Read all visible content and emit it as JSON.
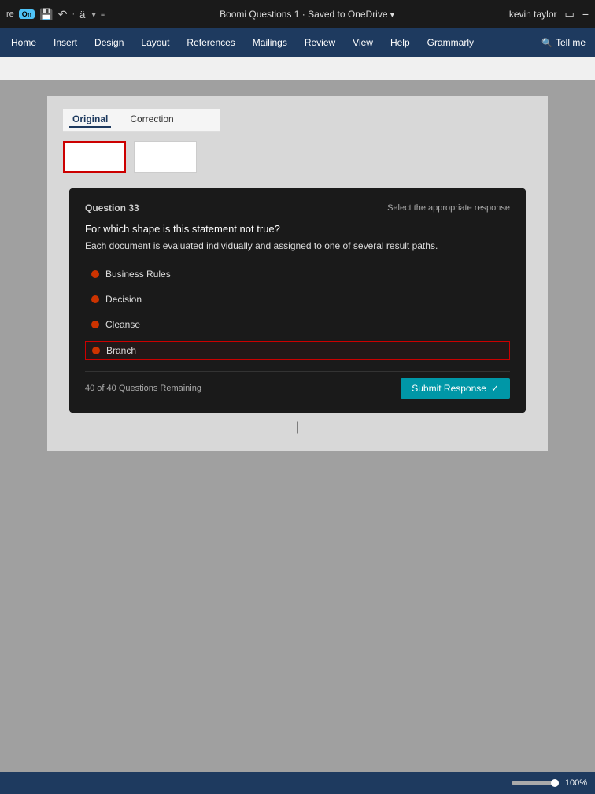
{
  "titlebar": {
    "on_label": "On",
    "doc_title": "Boomi Questions 1",
    "save_status": "Saved to OneDrive",
    "user_name": "kevin taylor"
  },
  "menubar": {
    "items": [
      {
        "label": "Home",
        "id": "home"
      },
      {
        "label": "Insert",
        "id": "insert"
      },
      {
        "label": "Design",
        "id": "design"
      },
      {
        "label": "Layout",
        "id": "layout"
      },
      {
        "label": "References",
        "id": "references"
      },
      {
        "label": "Mailings",
        "id": "mailings"
      },
      {
        "label": "Review",
        "id": "review"
      },
      {
        "label": "View",
        "id": "view"
      },
      {
        "label": "Help",
        "id": "help"
      },
      {
        "label": "Grammarly",
        "id": "grammarly"
      }
    ],
    "tell_me": "Tell me"
  },
  "track_changes": {
    "tabs": [
      {
        "label": "Original",
        "active": true
      },
      {
        "label": "Correction",
        "active": false
      }
    ]
  },
  "quiz": {
    "question_label": "Question 33",
    "prompt": "Select the appropriate response",
    "question_text": "For which shape is this statement not true?",
    "question_subtext": "Each document is evaluated individually and assigned to one of several result paths.",
    "options": [
      {
        "label": "Business Rules",
        "selected": false
      },
      {
        "label": "Decision",
        "selected": false
      },
      {
        "label": "Cleanse",
        "selected": false
      },
      {
        "label": "Branch",
        "selected": true
      }
    ],
    "questions_remaining": "40 of 40 Questions Remaining",
    "submit_label": "Submit Response",
    "submit_check": "✓"
  },
  "statusbar": {
    "zoom": "100%"
  }
}
